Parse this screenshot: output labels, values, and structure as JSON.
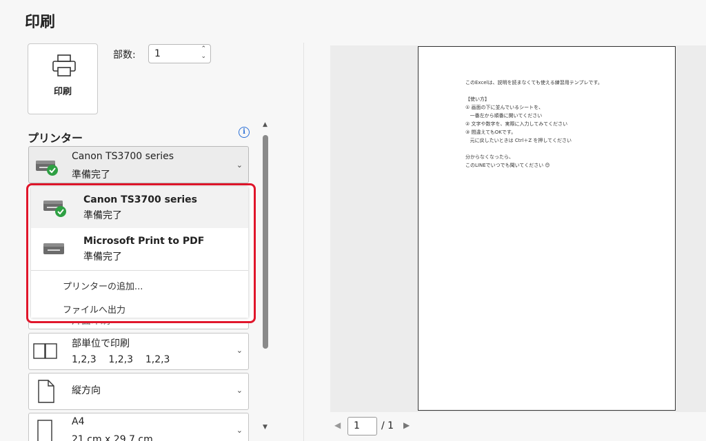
{
  "page": {
    "title": "印刷"
  },
  "print_button": {
    "label": "印刷"
  },
  "copies": {
    "label": "部数:",
    "value": "1"
  },
  "printer_section": {
    "title": "プリンター",
    "info_icon": "info-icon"
  },
  "selected_printer": {
    "name": "Canon TS3700 series",
    "status": "準備完了"
  },
  "printer_dropdown": {
    "options": [
      {
        "name": "Canon TS3700 series",
        "status": "準備完了"
      },
      {
        "name": "Microsoft Print to PDF",
        "status": "準備完了"
      }
    ],
    "add_printer": "プリンターの追加...",
    "print_to_file": "ファイルへ出力"
  },
  "partial_setting": {
    "text": "片面印刷"
  },
  "collation": {
    "title": "部単位で印刷",
    "detail": "1,2,3    1,2,3    1,2,3"
  },
  "orientation": {
    "title": "縦方向"
  },
  "paper": {
    "title": "A4",
    "detail": "21 cm x 29.7 cm"
  },
  "preview": {
    "lines": [
      "このExcelは、説明を読まなくても使える練習用テンプレです。",
      "",
      "【使い方】",
      "① 画面の下に並んでいるシートを、",
      "   一番左から順番に開いてください",
      "② 文字や数字を、実際に入力してみてください",
      "③ 間違えてもOKです。",
      "   元に戻したいときは Ctrl＋Z を押してください",
      "",
      "分からなくなったら、",
      "このLINEでいつでも聞いてください 😊"
    ]
  },
  "pager": {
    "current": "1",
    "total": "/ 1"
  },
  "colors": {
    "highlight_border": "#e0162b",
    "ready_check": "#2ea043",
    "info_blue": "#2a6fd6"
  }
}
